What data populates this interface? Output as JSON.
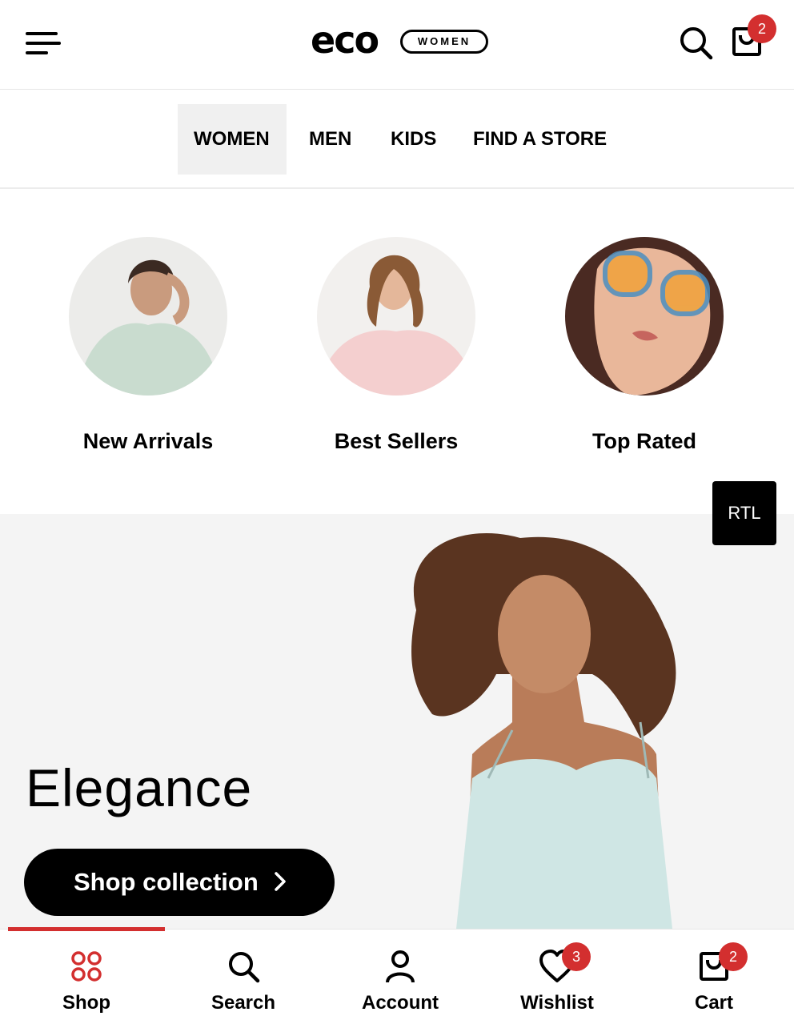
{
  "colors": {
    "accent": "#d32f2f",
    "text": "#000000",
    "nav_active_bg": "#f0f0f0",
    "hero_bg": "#f4f4f4"
  },
  "header": {
    "logo_word": "eco",
    "logo_tag": "WOMEN",
    "cart_count": "2",
    "icons": [
      "menu-icon",
      "search-icon",
      "shopping-bag-icon"
    ]
  },
  "nav": {
    "items": [
      {
        "label": "WOMEN",
        "active": true
      },
      {
        "label": "MEN",
        "active": false
      },
      {
        "label": "KIDS",
        "active": false
      },
      {
        "label": "FIND A STORE",
        "active": false
      }
    ]
  },
  "categories": [
    {
      "label": "New Arrivals"
    },
    {
      "label": "Best Sellers"
    },
    {
      "label": "Top Rated"
    }
  ],
  "rtl_button": "RTL",
  "hero": {
    "title": "Elegance",
    "cta": "Shop collection"
  },
  "tabbar": {
    "tabs": [
      {
        "label": "Shop",
        "icon": "grid-icon",
        "active": true
      },
      {
        "label": "Search",
        "icon": "search-icon",
        "active": false
      },
      {
        "label": "Account",
        "icon": "user-icon",
        "active": false
      },
      {
        "label": "Wishlist",
        "icon": "heart-icon",
        "badge": "3",
        "active": false
      },
      {
        "label": "Cart",
        "icon": "shopping-bag-icon",
        "badge": "2",
        "active": false
      }
    ]
  }
}
